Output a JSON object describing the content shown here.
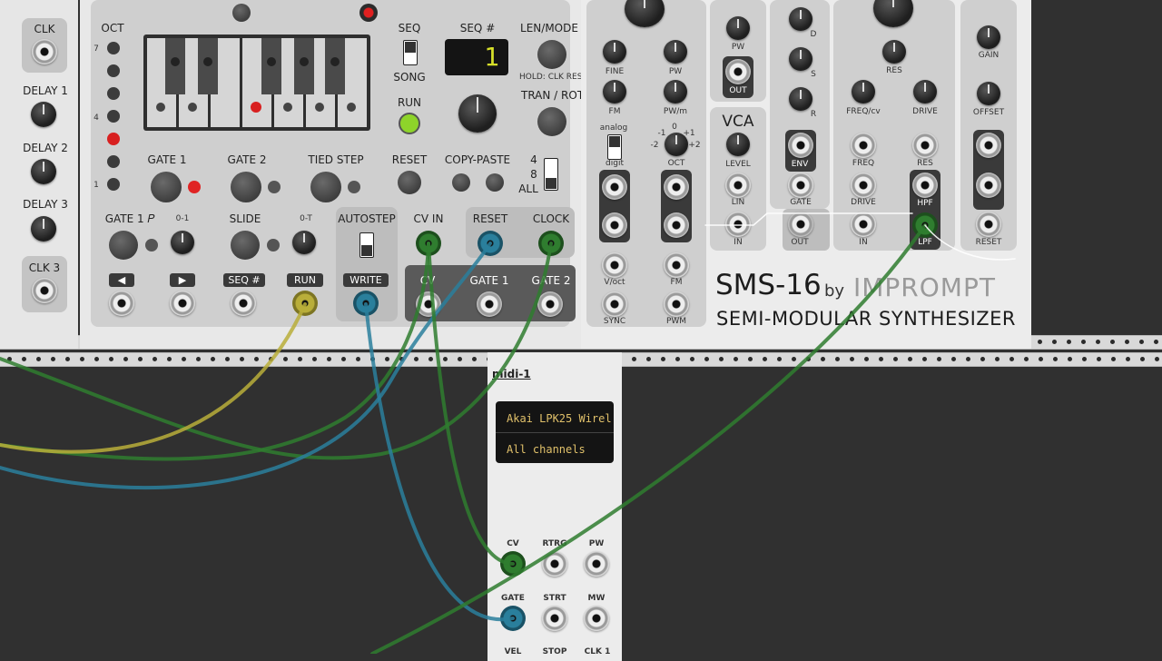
{
  "colors": {
    "rack": "#303030",
    "panel": "#e6e6e6",
    "section": "#cfcfcf",
    "green_cable": "#2f7d2f",
    "blue_cable": "#2a7f9c",
    "yellow_cable": "#b9ae3a",
    "display_text": "#e0c06a"
  },
  "left_module": {
    "labels": {
      "clk": "CLK",
      "delay1": "DELAY 1",
      "delay2": "DELAY 2",
      "delay3": "DELAY 3",
      "clk3": "CLK 3"
    }
  },
  "sequencer": {
    "oct_label": "OCT",
    "oct_numbers": {
      "n7": "7",
      "n4": "4",
      "n1": "1"
    },
    "seq_label": "SEQ",
    "song_label": "SONG",
    "run_label": "RUN",
    "seq_num_label": "SEQ #",
    "seq_display": "1",
    "len_mode_label": "LEN/MODE",
    "hold_label": "HOLD: CLK RES",
    "tran_rot_label": "TRAN / ROT",
    "gate1_label": "GATE 1",
    "gate2_label": "GATE 2",
    "tied_label": "TIED STEP",
    "reset_label": "RESET",
    "copy_paste_label": "COPY-PASTE",
    "cp_opts": {
      "four": "4",
      "eight": "8",
      "all": "ALL"
    },
    "gate1p_label": "GATE 1 𝑃",
    "range01_label": "0-1",
    "slide_label": "SLIDE",
    "range0t_label": "0-T",
    "autostep_label": "AUTOSTEP",
    "cvin_label": "CV IN",
    "reset2_label": "RESET",
    "clock_label": "CLOCK",
    "prev_label": "◀",
    "next_label": "▶",
    "seqnum_tag": "SEQ #",
    "run_tag": "RUN",
    "write_tag": "WRITE",
    "out_labels": {
      "cv": "CV",
      "gate1": "GATE 1",
      "gate2": "GATE 2"
    }
  },
  "synth": {
    "fine": "FINE",
    "pw": "PW",
    "fm": "FM",
    "pwm_knob": "PW/m",
    "analog": "analog",
    "digit": "digit",
    "oct": "OCT",
    "oct_scale": {
      "m1": "-1",
      "z": "0",
      "p1": "+1",
      "m2": "-2",
      "p2": "+2"
    },
    "voct": "V/oct",
    "fm_in": "FM",
    "sync": "SYNC",
    "pwm": "PWM",
    "pw_top": "PW",
    "out": "OUT",
    "vca": "VCA",
    "level": "LEVEL",
    "lin": "LIN",
    "in": "IN",
    "d": "D",
    "s": "S",
    "r": "R",
    "env": "ENV",
    "gate": "GATE",
    "out2": "OUT",
    "res": "RES",
    "freq_cv": "FREQ/cv",
    "drive": "DRIVE",
    "freq": "FREQ",
    "res2": "RES",
    "drive2": "DRIVE",
    "hpf": "HPF",
    "in2": "IN",
    "lpf": "LPF",
    "gain": "GAIN",
    "offset": "OFFSET",
    "reset": "RESET",
    "brand_title": "SMS-16",
    "brand_by": "by",
    "brand_maker": "IMPROMPT",
    "brand_subtitle": "SEMI-MODULAR SYNTHESIZER"
  },
  "midi": {
    "title": "midi-1",
    "device": "Akai LPK25 Wirel",
    "channel": "All channels",
    "cv": "CV",
    "rtrg": "RTRG",
    "pw": "PW",
    "gate": "GATE",
    "strt": "STRT",
    "mw": "MW",
    "vel": "VEL",
    "stop": "STOP",
    "clk1": "CLK 1"
  }
}
